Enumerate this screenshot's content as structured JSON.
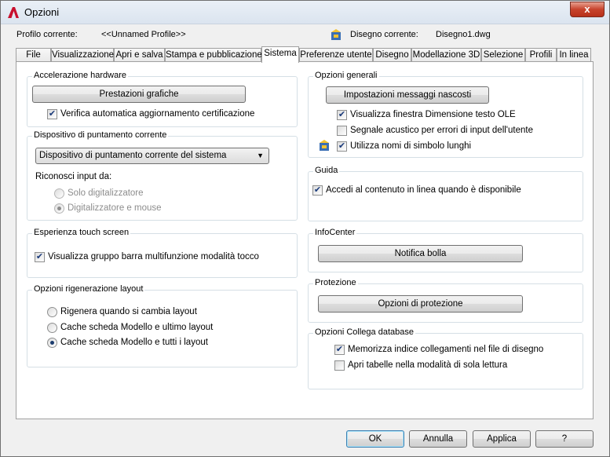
{
  "window": {
    "title": "Opzioni",
    "close_glyph": "x"
  },
  "profile": {
    "label": "Profilo corrente:",
    "value": "<<Unnamed Profile>>",
    "drawing_label": "Disegno corrente:",
    "drawing_value": "Disegno1.dwg"
  },
  "tabs": [
    {
      "label": "File"
    },
    {
      "label": "Visualizzazione"
    },
    {
      "label": "Apri e salva"
    },
    {
      "label": "Stampa e pubblicazione"
    },
    {
      "label": "Sistema"
    },
    {
      "label": "Preferenze utente"
    },
    {
      "label": "Disegno"
    },
    {
      "label": "Modellazione 3D"
    },
    {
      "label": "Selezione"
    },
    {
      "label": "Profili"
    },
    {
      "label": "In linea"
    }
  ],
  "active_tab": "Sistema",
  "hardware": {
    "title": "Accelerazione hardware",
    "button": "Prestazioni grafiche",
    "check": {
      "label": "Verifica automatica aggiornamento certificazione",
      "checked": true
    }
  },
  "pointing": {
    "title": "Dispositivo di puntamento corrente",
    "select_value": "Dispositivo di puntamento corrente del sistema",
    "input_label": "Riconosci input da:",
    "options": [
      {
        "label": "Solo digitalizzatore",
        "selected": false
      },
      {
        "label": "Digitalizzatore e mouse",
        "selected": true
      }
    ]
  },
  "touch": {
    "title": "Esperienza touch screen",
    "check": {
      "label": "Visualizza gruppo barra multifunzione modalità tocco",
      "checked": true
    }
  },
  "regen": {
    "title": "Opzioni rigenerazione layout",
    "options": [
      {
        "label": "Rigenera quando si cambia layout",
        "selected": false
      },
      {
        "label": "Cache scheda Modello e ultimo layout",
        "selected": false
      },
      {
        "label": "Cache scheda Modello e tutti i layout",
        "selected": true
      }
    ]
  },
  "general": {
    "title": "Opzioni generali",
    "button": "Impostazioni messaggi nascosti",
    "checks": [
      {
        "label": "Visualizza finestra Dimensione testo OLE",
        "checked": true
      },
      {
        "label": "Segnale acustico per errori di input dell'utente",
        "checked": false
      },
      {
        "label": "Utilizza nomi di simbolo lunghi",
        "checked": true
      }
    ]
  },
  "help": {
    "title": "Guida",
    "check": {
      "label": "Accedi al contenuto in linea quando è disponibile",
      "checked": true
    }
  },
  "infocenter": {
    "title": "InfoCenter",
    "button": "Notifica bolla"
  },
  "security": {
    "title": "Protezione",
    "button": "Opzioni di protezione"
  },
  "dbconnect": {
    "title": "Opzioni Collega database",
    "checks": [
      {
        "label": "Memorizza indice collegamenti nel file di disegno",
        "checked": true
      },
      {
        "label": "Apri tabelle nella modalità di sola lettura",
        "checked": false
      }
    ]
  },
  "footer": {
    "ok": "OK",
    "cancel": "Annulla",
    "apply": "Applica",
    "help": "?"
  },
  "check_glyph": "✔"
}
